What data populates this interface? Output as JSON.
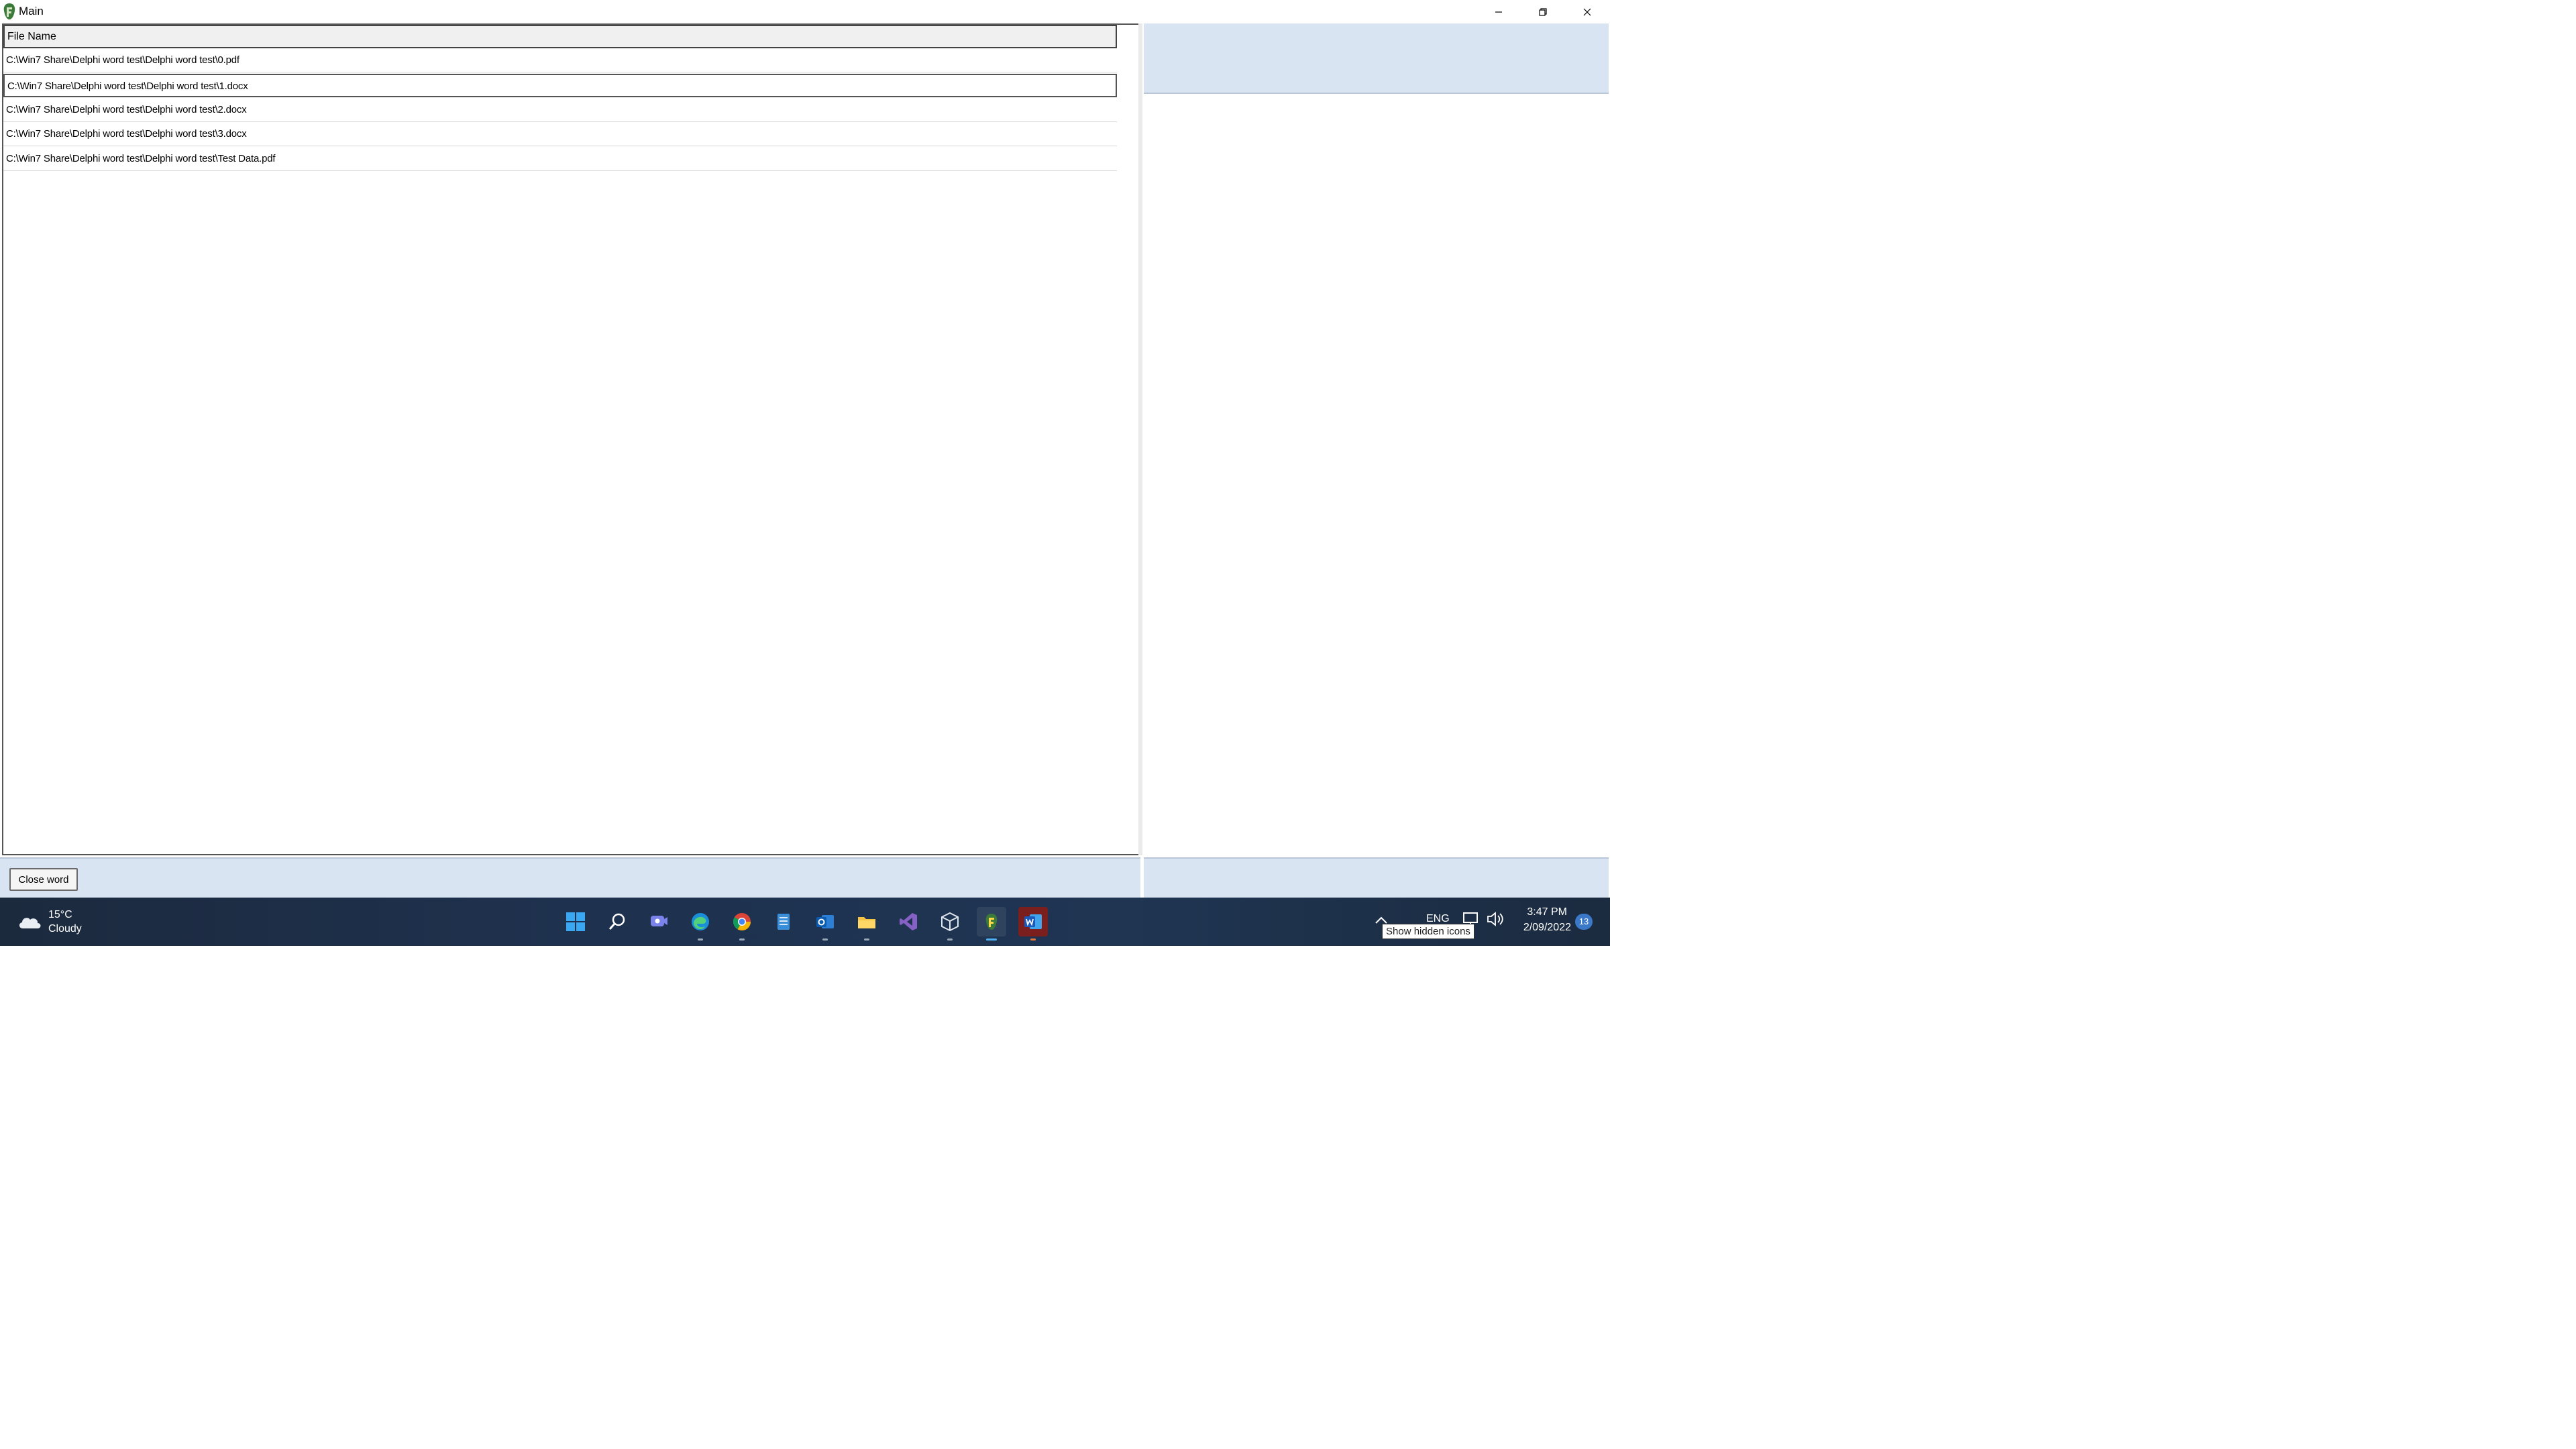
{
  "window": {
    "title": "Main"
  },
  "listview": {
    "column_header": "File Name",
    "rows": [
      "C:\\Win7 Share\\Delphi word test\\Delphi word test\\0.pdf",
      "C:\\Win7 Share\\Delphi word test\\Delphi word test\\1.docx",
      "C:\\Win7 Share\\Delphi word test\\Delphi word test\\2.docx",
      "C:\\Win7 Share\\Delphi word test\\Delphi word test\\3.docx",
      "C:\\Win7 Share\\Delphi word test\\Delphi word test\\Test Data.pdf"
    ]
  },
  "bottom": {
    "close_word_label": "Close word"
  },
  "taskbar": {
    "weather": {
      "temp": "15°C",
      "desc": "Cloudy",
      "icon": "cloud-icon"
    },
    "icons": [
      "start-icon",
      "search-icon",
      "chat-icon",
      "edge-icon",
      "chrome-icon",
      "notepad-icon",
      "outlook-icon",
      "file-explorer-icon",
      "visual-studio-icon",
      "virtualbox-icon",
      "delphi-icon",
      "word-icon"
    ],
    "tray": {
      "lang": "ENG",
      "time": "3:47 PM",
      "date": "2/09/2022",
      "notifications": "13"
    },
    "tooltip": "Show hidden icons"
  },
  "colors": {
    "panel": "#d8e4f2",
    "taskbar": "#1e3250",
    "accent": "#4fb3f6"
  }
}
